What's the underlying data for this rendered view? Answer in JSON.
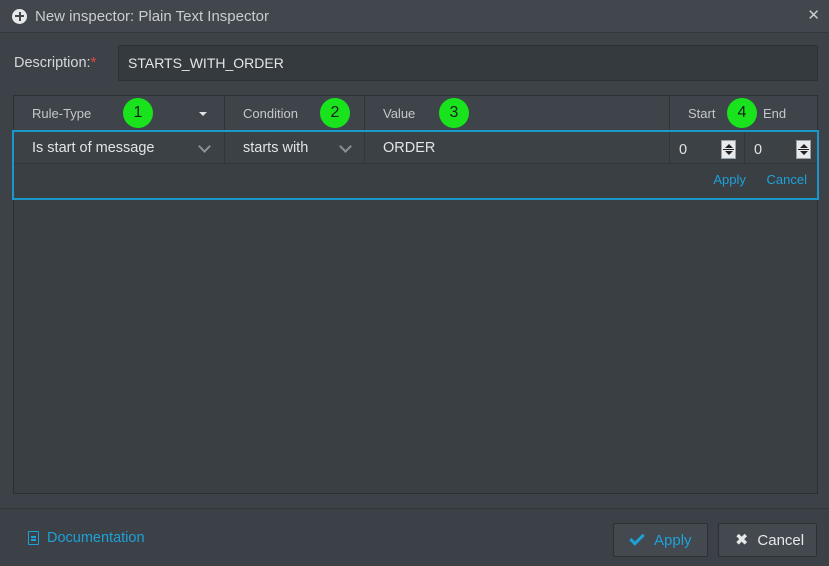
{
  "window": {
    "title": "New inspector: Plain Text Inspector",
    "close_glyph": "✕"
  },
  "description": {
    "label": "Description:",
    "required_mark": "*",
    "value": "STARTS_WITH_ORDER"
  },
  "grid": {
    "columns": {
      "rule_type": "Rule-Type",
      "condition": "Condition",
      "value": "Value",
      "start": "Start",
      "end": "End"
    },
    "badges": [
      "1",
      "2",
      "3",
      "4"
    ],
    "row": {
      "rule_type": "Is start of message",
      "condition": "starts with",
      "value": "ORDER",
      "start": "0",
      "end": "0"
    },
    "row_actions": {
      "apply": "Apply",
      "cancel": "Cancel"
    }
  },
  "footer": {
    "documentation": "Documentation",
    "apply": "Apply",
    "cancel": "Cancel"
  },
  "colors": {
    "accent": "#1ea1d8",
    "badge": "#19e31d",
    "required": "#e8473f",
    "background": "#3c4247"
  },
  "icons": [
    "plus-circle-icon",
    "close-icon",
    "caret-down-icon",
    "chevron-down-icon",
    "spinner-icon",
    "document-icon",
    "check-icon",
    "x-icon"
  ]
}
